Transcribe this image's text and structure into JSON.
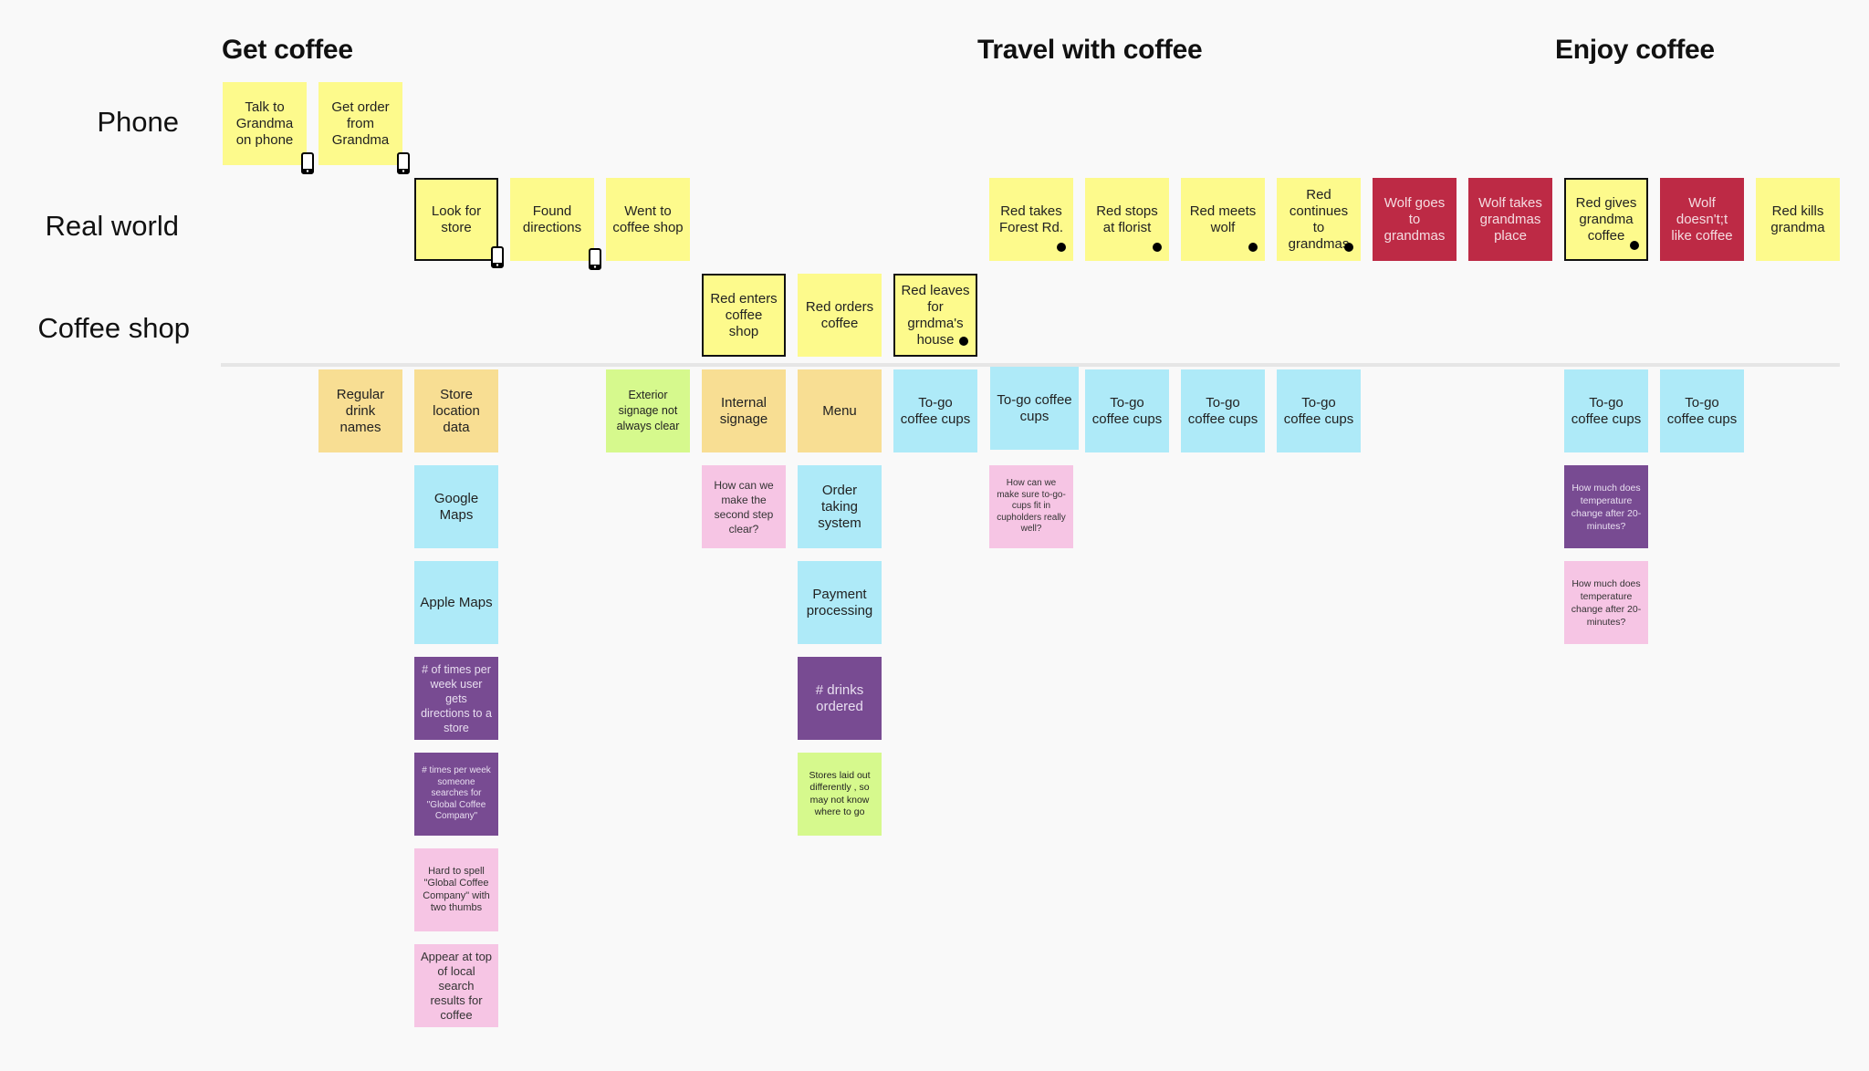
{
  "stages": [
    {
      "title": "Get coffee"
    },
    {
      "title": "Travel with coffee"
    },
    {
      "title": "Enjoy coffee"
    }
  ],
  "lanes": [
    {
      "label": "Phone"
    },
    {
      "label": "Real world"
    },
    {
      "label": "Coffee shop"
    }
  ],
  "colors": {
    "yellow": "#fdfa8c",
    "red": "#bd2a45",
    "orange": "#f8de93",
    "blue": "#aeeaf8",
    "green": "#d6f98d",
    "pink": "#f6c5e4",
    "purple": "#784b92",
    "background": "#f9f9f9"
  },
  "journey": [
    {
      "text": "Talk to Grandma on phone",
      "color": "yellow",
      "lane": "Phone",
      "icon": "phone-icon"
    },
    {
      "text": "Get order from Grandma",
      "color": "yellow",
      "lane": "Phone",
      "icon": "phone-icon"
    },
    {
      "text": "Look for store",
      "color": "yellow",
      "lane": "Real world",
      "icon": "phone-icon",
      "selected": true
    },
    {
      "text": "Found directions",
      "color": "yellow",
      "lane": "Real world",
      "icon": "phone-icon"
    },
    {
      "text": "Went to coffee shop",
      "color": "yellow",
      "lane": "Real world"
    },
    {
      "text": "Red enters coffee shop",
      "color": "yellow",
      "lane": "Coffee shop",
      "selected": true
    },
    {
      "text": "Red orders coffee",
      "color": "yellow",
      "lane": "Coffee shop"
    },
    {
      "text": "Red leaves for grndma's house",
      "color": "yellow",
      "lane": "Coffee shop",
      "icon": "dot-icon",
      "selected": true
    },
    {
      "text": "Red takes Forest Rd.",
      "color": "yellow",
      "lane": "Real world",
      "icon": "dot-icon"
    },
    {
      "text": "Red stops at florist",
      "color": "yellow",
      "lane": "Real world",
      "icon": "dot-icon"
    },
    {
      "text": "Red meets wolf",
      "color": "yellow",
      "lane": "Real world",
      "icon": "dot-icon"
    },
    {
      "text": "Red continues to grandmas",
      "color": "yellow",
      "lane": "Real world",
      "icon": "dot-icon"
    },
    {
      "text": "Wolf goes to grandmas",
      "color": "red",
      "lane": "Real world"
    },
    {
      "text": "Wolf takes grandmas place",
      "color": "red",
      "lane": "Real world"
    },
    {
      "text": "Red gives grandma coffee",
      "color": "yellow",
      "lane": "Real world",
      "icon": "dot-icon",
      "selected": true
    },
    {
      "text": "Wolf doesn't;t like coffee",
      "color": "red",
      "lane": "Real world"
    },
    {
      "text": "Red kills grandma",
      "color": "yellow",
      "lane": "Real world"
    }
  ],
  "details": [
    {
      "text": "Regular drink names",
      "color": "orange"
    },
    {
      "text": "Store location data",
      "color": "orange"
    },
    {
      "text": "Google Maps",
      "color": "blue"
    },
    {
      "text": "Apple Maps",
      "color": "blue"
    },
    {
      "text": "# of times per week user gets directions to a store",
      "color": "purple"
    },
    {
      "text": "# times per week someone searches for \"Global Coffee Company\"",
      "color": "purple"
    },
    {
      "text": "Hard to spell \"Global Coffee Company\" with two thumbs",
      "color": "pink"
    },
    {
      "text": "Appear at top of local search results for coffee",
      "color": "pink"
    },
    {
      "text": "Exterior signage not always clear",
      "color": "green"
    },
    {
      "text": "Internal signage",
      "color": "orange"
    },
    {
      "text": "How can we make the second step clear?",
      "color": "pink"
    },
    {
      "text": "Menu",
      "color": "orange"
    },
    {
      "text": "Order taking system",
      "color": "blue"
    },
    {
      "text": "Payment processing",
      "color": "blue"
    },
    {
      "text": "# drinks ordered",
      "color": "purple"
    },
    {
      "text": "Stores laid out differently , so may not know where to go",
      "color": "green"
    },
    {
      "text": "To-go coffee cups",
      "color": "blue"
    },
    {
      "text": "To-go coffee cups",
      "color": "blue"
    },
    {
      "text": "How can we make sure to-go-cups fit in cupholders really well?",
      "color": "pink"
    },
    {
      "text": "To-go coffee cups",
      "color": "blue"
    },
    {
      "text": "To-go coffee cups",
      "color": "blue"
    },
    {
      "text": "To-go coffee cups",
      "color": "blue"
    },
    {
      "text": "To-go coffee cups",
      "color": "blue"
    },
    {
      "text": "How much does temperature change after 20-minutes?",
      "color": "purple"
    },
    {
      "text": "How much does temperature change after 20-minutes?",
      "color": "pink"
    },
    {
      "text": "To-go coffee cups",
      "color": "blue"
    }
  ]
}
